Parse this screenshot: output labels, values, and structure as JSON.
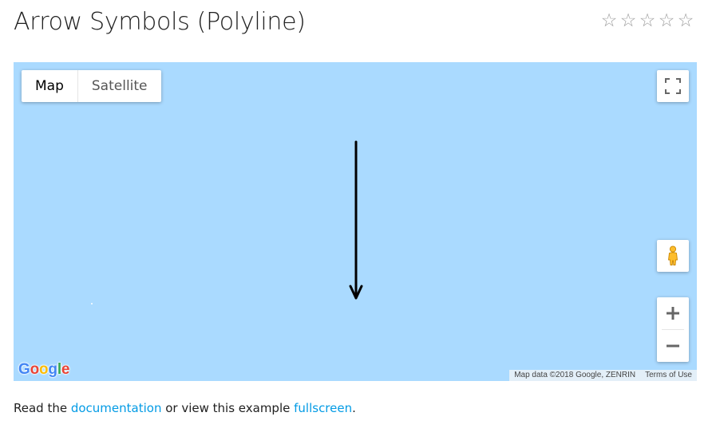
{
  "page": {
    "title": "Arrow Symbols (Polyline)"
  },
  "rating": {
    "stars": [
      "☆",
      "☆",
      "☆",
      "☆",
      "☆"
    ]
  },
  "map": {
    "maptype": {
      "map_label": "Map",
      "satellite_label": "Satellite",
      "selected": "Map"
    },
    "zoom_in_icon": "plus-icon",
    "zoom_out_icon": "minus-icon",
    "fullscreen_icon": "fullscreen-icon",
    "pegman_icon": "pegman-icon",
    "water_color": "#aadaff",
    "polyline": {
      "color": "#000000",
      "symbol": "forward-closed-arrow"
    },
    "logo_text": "Google",
    "attribution": {
      "data_text": "Map data ©2018 Google, ZENRIN",
      "terms_text": "Terms of Use"
    }
  },
  "footer": {
    "prefix": "Read the ",
    "documentation_link": "documentation",
    "middle": " or view this example ",
    "fullscreen_link": "fullscreen",
    "suffix": "."
  },
  "colors": {
    "link": "#039be5",
    "star": "#9e9e9e"
  }
}
